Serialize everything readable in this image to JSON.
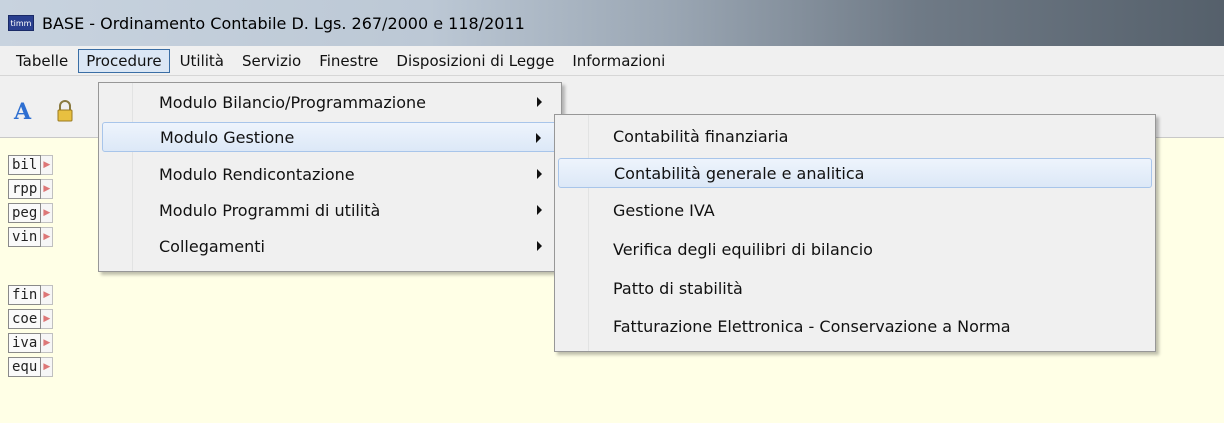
{
  "window": {
    "app_icon_text": "timm",
    "title": "BASE - Ordinamento Contabile D. Lgs. 267/2000 e 118/2011"
  },
  "menubar": {
    "items": [
      {
        "label": "Tabelle"
      },
      {
        "label": "Procedure"
      },
      {
        "label": "Utilità"
      },
      {
        "label": "Servizio"
      },
      {
        "label": "Finestre"
      },
      {
        "label": "Disposizioni di Legge"
      },
      {
        "label": "Informazioni"
      }
    ],
    "active": "Procedure"
  },
  "toolbar": {
    "icons": [
      "text-a-icon",
      "lock-icon"
    ]
  },
  "sidebar": {
    "buttons": [
      {
        "code": "bil"
      },
      {
        "code": "rpp"
      },
      {
        "code": "peg"
      },
      {
        "code": "vin"
      },
      {
        "code": "fin"
      },
      {
        "code": "coe"
      },
      {
        "code": "iva"
      },
      {
        "code": "equ"
      }
    ]
  },
  "procedure_menu": {
    "items": [
      {
        "label": "Modulo Bilancio/Programmazione"
      },
      {
        "label": "Modulo Gestione"
      },
      {
        "label": "Modulo Rendicontazione"
      },
      {
        "label": "Modulo Programmi di utilità"
      },
      {
        "label": "Collegamenti"
      }
    ],
    "highlighted": "Modulo Gestione"
  },
  "gestione_submenu": {
    "items": [
      {
        "label": "Contabilità finanziaria"
      },
      {
        "label": "Contabilità generale e analitica"
      },
      {
        "label": "Gestione IVA"
      },
      {
        "label": "Verifica degli equilibri di bilancio"
      },
      {
        "label": "Patto di stabilità"
      },
      {
        "label": "Fatturazione Elettronica - Conservazione a Norma"
      }
    ],
    "highlighted": "Contabilità generale e analitica"
  },
  "colors": {
    "workarea_bg": "#ffffe6",
    "highlight_border": "#a8c5ea",
    "menu_bg": "#f0f0f0"
  }
}
